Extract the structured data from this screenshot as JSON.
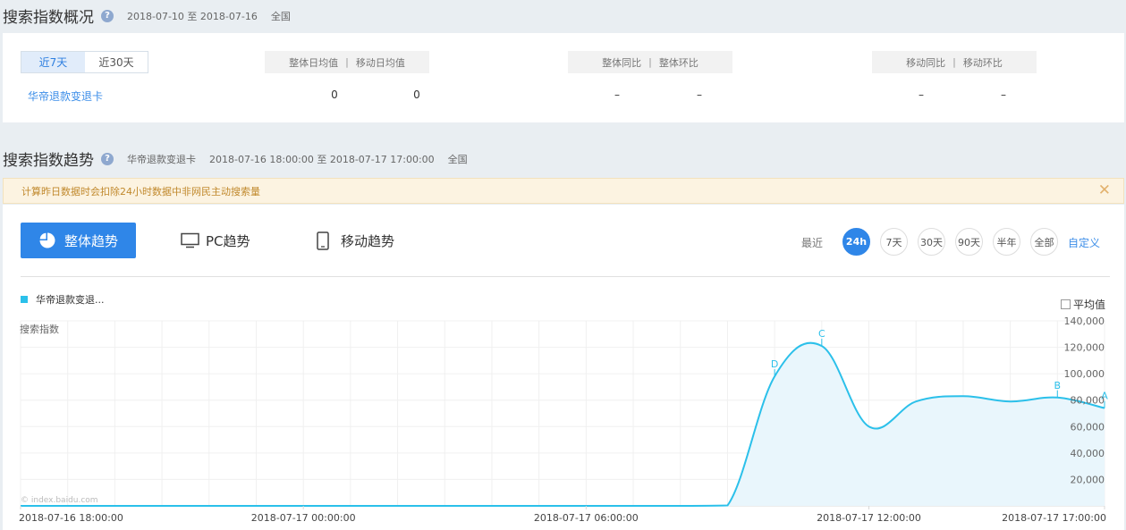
{
  "overview": {
    "title": "搜索指数概况",
    "help_icon": "?",
    "date_range": "2018-07-10 至 2018-07-16",
    "region": "全国",
    "range_tabs": [
      "近7天",
      "近30天"
    ],
    "keyword": "华帝退款变退卡",
    "header1": [
      "整体日均值",
      "移动日均值"
    ],
    "header2": [
      "整体同比",
      "整体环比"
    ],
    "header3": [
      "移动同比",
      "移动环比"
    ],
    "separator": "|",
    "values": [
      "0",
      "0",
      "–",
      "–",
      "–",
      "–"
    ]
  },
  "trend": {
    "title": "搜索指数趋势",
    "help_icon": "?",
    "keyword": "华帝退款变退卡",
    "date_range": "2018-07-16 18:00:00 至 2018-07-17 17:00:00",
    "region": "全国",
    "notice": "计算昨日数据时会扣除24小时数据中非网民主动搜索量",
    "notice_close": "✕",
    "tabs": {
      "overall": "整体趋势",
      "pc": "PC趋势",
      "mobile": "移动趋势"
    },
    "recent_label": "最近",
    "time_ranges": [
      "24h",
      "7天",
      "30天",
      "90天",
      "半年",
      "全部"
    ],
    "active_time_range": "24h",
    "custom_label": "自定义",
    "legend_label": "华帝退款变退...",
    "avg_label": "平均值",
    "watermark": "© index.baidu.com",
    "accent_color": "#2f86e8",
    "series_color": "#2bc0ea"
  },
  "chart_data": {
    "type": "area",
    "ylabel": "搜索指数",
    "y_ticks": [
      "140,000",
      "120,000",
      "100,000",
      "80,000",
      "60,000",
      "40,000",
      "20,000"
    ],
    "ylim": [
      0,
      140000
    ],
    "x_labels": [
      "2018-07-16 18:00:00",
      "2018-07-17 00:00:00",
      "2018-07-17 06:00:00",
      "2018-07-17 12:00:00",
      "2018-07-17 17:00:00"
    ],
    "x_label_hours": [
      0,
      6,
      12,
      18,
      23
    ],
    "x": [
      "18:00",
      "19:00",
      "20:00",
      "21:00",
      "22:00",
      "23:00",
      "00:00",
      "01:00",
      "02:00",
      "03:00",
      "04:00",
      "05:00",
      "06:00",
      "07:00",
      "08:00",
      "09:00",
      "10:00",
      "11:00",
      "12:00",
      "13:00",
      "14:00",
      "15:00",
      "16:00",
      "17:00"
    ],
    "series": [
      {
        "name": "华帝退款变退...",
        "values": [
          0,
          0,
          0,
          0,
          0,
          0,
          0,
          0,
          0,
          0,
          0,
          0,
          0,
          0,
          0,
          300,
          98000,
          121000,
          60000,
          79000,
          83000,
          79000,
          82000,
          74000
        ]
      }
    ],
    "annotations": [
      {
        "label": "D",
        "index": 16
      },
      {
        "label": "C",
        "index": 17
      },
      {
        "label": "B",
        "index": 22
      },
      {
        "label": "A",
        "index": 23
      }
    ],
    "grid": true
  }
}
